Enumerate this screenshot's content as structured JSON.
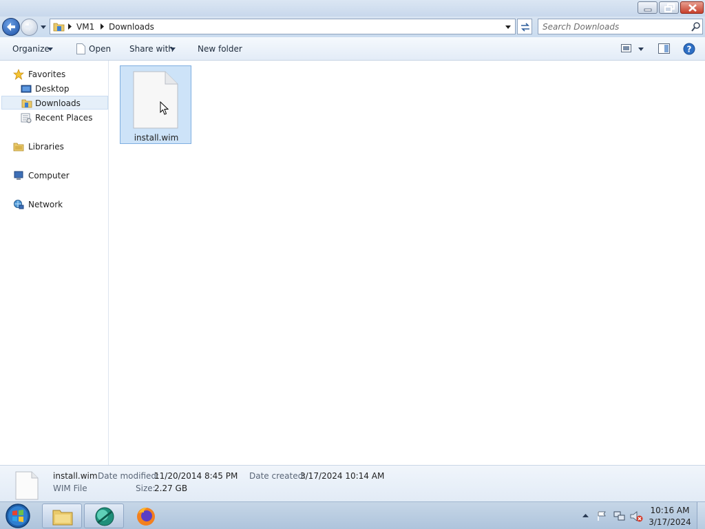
{
  "window": {
    "controls": {
      "minimize": "minimize",
      "maximize": "maximize",
      "close": "close"
    }
  },
  "address": {
    "crumbs": [
      "VM1",
      "Downloads"
    ]
  },
  "search": {
    "placeholder": "Search Downloads"
  },
  "commandbar": {
    "organize": "Organize",
    "open": "Open",
    "share_with": "Share with",
    "new_folder": "New folder"
  },
  "nav": {
    "favorites": "Favorites",
    "desktop": "Desktop",
    "downloads": "Downloads",
    "recent_places": "Recent Places",
    "libraries": "Libraries",
    "computer": "Computer",
    "network": "Network"
  },
  "files": [
    {
      "name": "install.wim",
      "selected": true
    }
  ],
  "details": {
    "name": "install.wim",
    "type": "WIM File",
    "date_modified_label": "Date modified:",
    "date_modified": "11/20/2014 8:45 PM",
    "size_label": "Size:",
    "size": "2.27 GB",
    "date_created_label": "Date created:",
    "date_created": "3/17/2024 10:14 AM"
  },
  "taskbar": {
    "time": "10:16 AM",
    "date": "3/17/2024"
  },
  "colors": {
    "selection_fill": "#cde3f8",
    "selection_border": "#7eaee0",
    "nav_selected": "#e5eff9"
  }
}
